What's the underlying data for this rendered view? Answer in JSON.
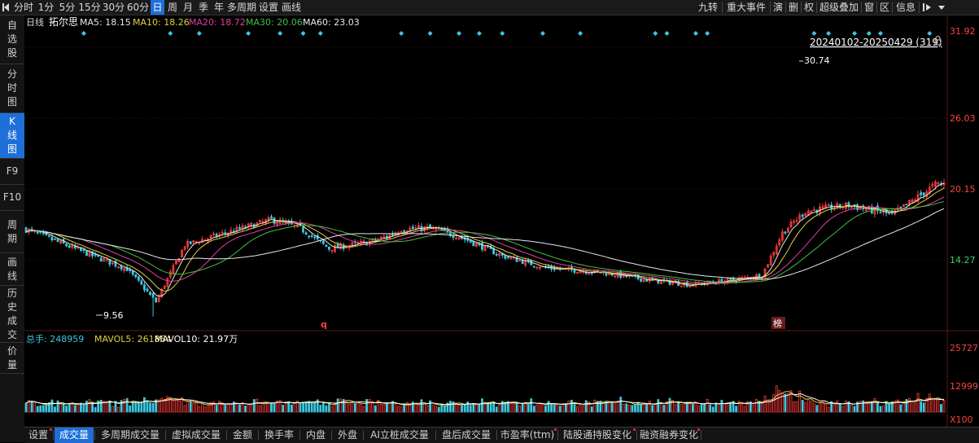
{
  "toolbar": {
    "left_items": [
      "分时",
      "1分",
      "5分",
      "15分",
      "30分",
      "60分",
      "日",
      "周",
      "月",
      "季",
      "年",
      "多周期",
      "设置",
      "画线"
    ],
    "active": "日",
    "right_items": [
      "九转",
      "重大事件",
      "演",
      "删",
      "权",
      "超级叠加",
      "窗",
      "区",
      "信息"
    ]
  },
  "sidebar": {
    "items": [
      {
        "label": "自选股",
        "active": false
      },
      {
        "label": "分时图",
        "active": false
      },
      {
        "label": "K线图",
        "active": true
      },
      {
        "label": "F9",
        "active": false
      },
      {
        "label": "F10",
        "active": false
      },
      {
        "label": "周期",
        "active": false
      },
      {
        "label": "画线",
        "active": false
      },
      {
        "label": "历史成交",
        "active": false
      },
      {
        "label": "价量",
        "active": false
      }
    ]
  },
  "main_chart": {
    "period": "日线",
    "stock_name": "拓尔思",
    "ma_values": [
      {
        "label": "MA5: 18.15",
        "color": "#e8e8e8"
      },
      {
        "label": "MA10: 18.26",
        "color": "#e0d040"
      },
      {
        "label": "MA20: 18.72",
        "color": "#e040a0"
      },
      {
        "label": "MA30: 20.06",
        "color": "#40c040"
      },
      {
        "label": "MA60: 23.03",
        "color": "#e8e8e8"
      }
    ],
    "date_range": "20240102-20250429 (319)",
    "price_ticks": [
      "31.92",
      "26.03",
      "20.15",
      "14.27"
    ],
    "high_label": "30.74",
    "low_label": "9.56",
    "markers": [
      "q",
      "榜"
    ]
  },
  "volume_chart": {
    "total_label": "总手: 248959",
    "mavol5_label": "MAVOL5: 261864",
    "mavol10_label": "MAVOL10: 21.97万",
    "ticks": [
      "25727",
      "12999",
      "X100"
    ]
  },
  "bottom_tabs": [
    {
      "label": "设置",
      "dot": true,
      "active": false
    },
    {
      "label": "成交量",
      "dot": false,
      "active": true
    },
    {
      "label": "多周期成交量",
      "dot": false,
      "active": false
    },
    {
      "label": "虚拟成交量",
      "dot": false,
      "active": false
    },
    {
      "label": "金额",
      "dot": false,
      "active": false
    },
    {
      "label": "换手率",
      "dot": false,
      "active": false
    },
    {
      "label": "内盘",
      "dot": false,
      "active": false
    },
    {
      "label": "外盘",
      "dot": false,
      "active": false
    },
    {
      "label": "AI立桩成交量",
      "dot": false,
      "active": false
    },
    {
      "label": "盘后成交量",
      "dot": false,
      "active": false
    },
    {
      "label": "市盈率(ttm)",
      "dot": true,
      "active": false
    },
    {
      "label": "陆股通持股变化",
      "dot": true,
      "active": false
    },
    {
      "label": "融资融券变化",
      "dot": true,
      "active": false
    }
  ],
  "colors": {
    "up": "#ff3b3b",
    "down": "#3cc8e0",
    "ma5": "#e8e8e8",
    "ma10": "#e0d040",
    "ma20": "#e040a0",
    "ma30": "#40c040",
    "ma60": "#e8e8e8",
    "active": "#1e6fd9"
  },
  "chart_data": {
    "type": "candlestick",
    "count": 319,
    "price_axis": [
      14.27,
      20.15,
      26.03,
      31.92
    ],
    "price_anchors": [
      [
        0,
        16.8
      ],
      [
        20,
        14.9
      ],
      [
        35,
        13.5
      ],
      [
        45,
        10.8
      ],
      [
        55,
        15.5
      ],
      [
        65,
        16.2
      ],
      [
        75,
        16.9
      ],
      [
        85,
        17.6
      ],
      [
        95,
        16.9
      ],
      [
        105,
        15.2
      ],
      [
        118,
        15.7
      ],
      [
        125,
        16.2
      ],
      [
        130,
        16.8
      ],
      [
        140,
        16.9
      ],
      [
        150,
        16.2
      ],
      [
        165,
        14.6
      ],
      [
        180,
        13.6
      ],
      [
        200,
        13.2
      ],
      [
        215,
        12.6
      ],
      [
        230,
        12.2
      ],
      [
        245,
        12.6
      ],
      [
        255,
        13.0
      ],
      [
        262,
        16.5
      ],
      [
        270,
        18.3
      ],
      [
        285,
        18.8
      ],
      [
        300,
        18.0
      ],
      [
        315,
        20.5
      ],
      [
        325,
        20.8
      ],
      [
        335,
        19.4
      ],
      [
        345,
        21.8
      ],
      [
        350,
        25.8
      ],
      [
        355,
        27.2
      ],
      [
        365,
        24.2
      ],
      [
        372,
        23.8
      ],
      [
        380,
        21.3
      ],
      [
        390,
        18.5
      ],
      [
        395,
        17.9
      ],
      [
        405,
        18.3
      ],
      [
        410,
        17.9
      ]
    ],
    "high": 30.74,
    "low": 9.56,
    "volume_axis": [
      12999,
      25727
    ]
  }
}
